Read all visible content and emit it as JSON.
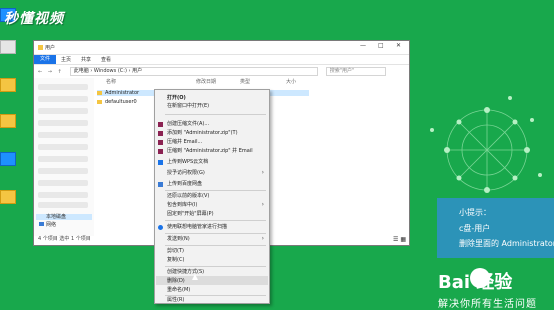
{
  "watermark": "秒懂视频",
  "window": {
    "title": "用户",
    "controls": [
      "—",
      "□",
      "✕"
    ],
    "ribbon": {
      "file": "文件",
      "tabs": [
        "主页",
        "共享",
        "查看"
      ]
    },
    "nav_arrows": "← → ↑",
    "address": "此电脑 › Windows (C:) › 用户",
    "search_placeholder": "搜索\"用户\"",
    "columns": [
      "名称",
      "修改日期",
      "类型",
      "大小"
    ],
    "files": [
      {
        "name": "Administrator",
        "selected": true
      },
      {
        "name": "defaultuser0",
        "selected": false
      }
    ],
    "nav_network": "网络",
    "nav_drive": "本地磁盘",
    "status": "4 个项目   选中 1 个项目",
    "view_buttons": "☰ ▦"
  },
  "context_menu": {
    "items": [
      {
        "label": "打开(O)",
        "bold": true,
        "icon": "none"
      },
      {
        "label": "在新窗口中打开(E)",
        "icon": "none"
      },
      {
        "label": "创建压缩文件(A)...",
        "icon": "winrar-icon"
      },
      {
        "label": "添加到 \"Administrator.zip\"(T)",
        "icon": "winrar-icon"
      },
      {
        "label": "压缩并 Email...",
        "icon": "winrar-icon"
      },
      {
        "label": "压缩到 \"Administrator.zip\" 并 Email",
        "icon": "winrar-icon"
      },
      {
        "label": "上传到WPS云文档",
        "icon": "wps-cloud-icon"
      },
      {
        "label": "授予访问权限(G)",
        "icon": "none",
        "submenu": true
      },
      {
        "label": "上传到百度网盘",
        "icon": "baidu-netdisk-icon"
      },
      {
        "label": "还原以前的版本(V)",
        "icon": "none"
      },
      {
        "label": "包含到库中(I)",
        "icon": "none",
        "submenu": true
      },
      {
        "label": "固定到\"开始\"屏幕(P)",
        "icon": "none"
      },
      {
        "label": "使用联想电脑管家进行扫描",
        "icon": "shield-icon"
      },
      {
        "label": "发送到(N)",
        "icon": "none",
        "submenu": true
      },
      {
        "label": "剪切(T)",
        "icon": "none"
      },
      {
        "label": "复制(C)",
        "icon": "none"
      },
      {
        "label": "创建快捷方式(S)",
        "icon": "none"
      },
      {
        "label": "删除(D)",
        "icon": "none",
        "highlighted": true
      },
      {
        "label": "重命名(M)",
        "icon": "none"
      },
      {
        "label": "属性(R)",
        "icon": "none"
      }
    ]
  },
  "tip": {
    "title": "小提示：",
    "line1": "c盘-用户",
    "line2": "删除里面的 Administrator"
  },
  "brand": {
    "logo": "Bai 经验",
    "slogan": "解决你所有生活问题"
  }
}
